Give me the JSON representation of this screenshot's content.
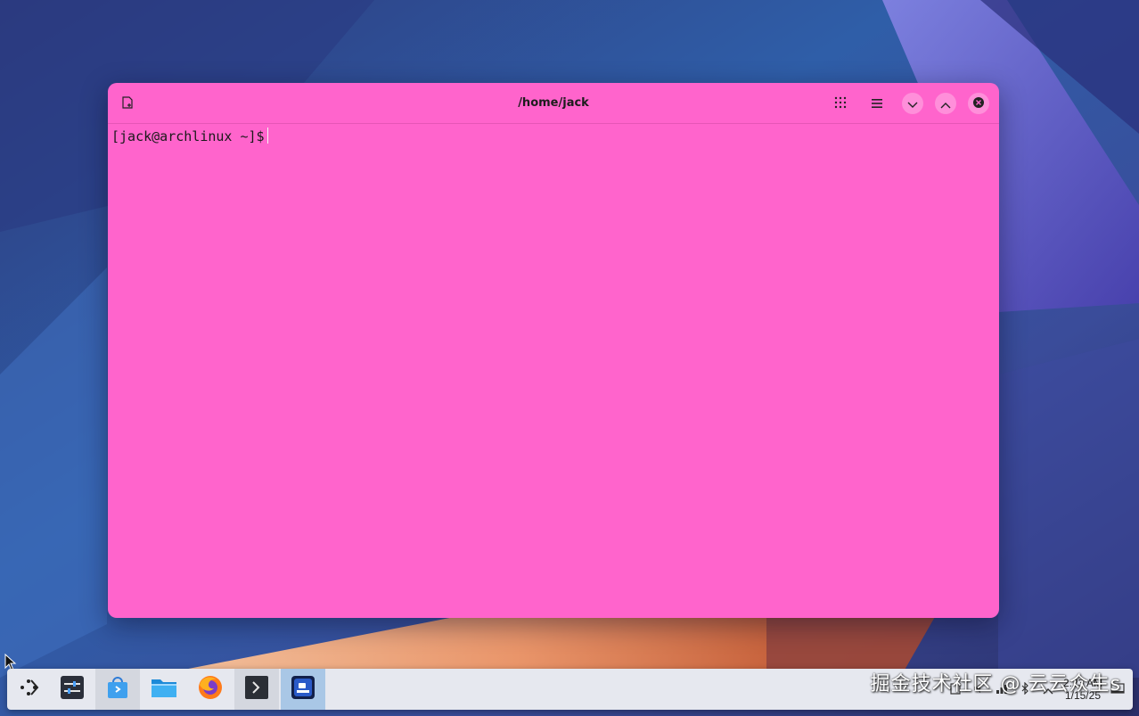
{
  "window": {
    "title": "/home/jack",
    "prompt": "[jack@archlinux ~]$"
  },
  "titlebar_icons": {
    "new_tab": "new-tab-icon",
    "overview": "grid-icon",
    "menu": "hamburger-menu-icon",
    "minimize": "chevron-down-icon",
    "maximize": "chevron-up-icon",
    "close": "close-icon"
  },
  "taskbar": {
    "items": [
      {
        "name": "application-launcher",
        "icon": "launcher-icon"
      },
      {
        "name": "system-settings",
        "icon": "settings-icon"
      },
      {
        "name": "discover",
        "icon": "store-icon"
      },
      {
        "name": "dolphin-file-manager",
        "icon": "folder-icon"
      },
      {
        "name": "firefox",
        "icon": "firefox-icon"
      },
      {
        "name": "konsole",
        "icon": "terminal-icon"
      },
      {
        "name": "terminal-window",
        "icon": "terminal-window-icon"
      }
    ],
    "clock": {
      "time": "2:23 AM",
      "date": "1/15/25"
    }
  },
  "watermark": "掘金技术社区 @ 云云众生s",
  "colors": {
    "terminal_bg": "#ff64cc",
    "taskbar_bg": "#e6e8ef",
    "active_task": "#a9c7e6"
  }
}
